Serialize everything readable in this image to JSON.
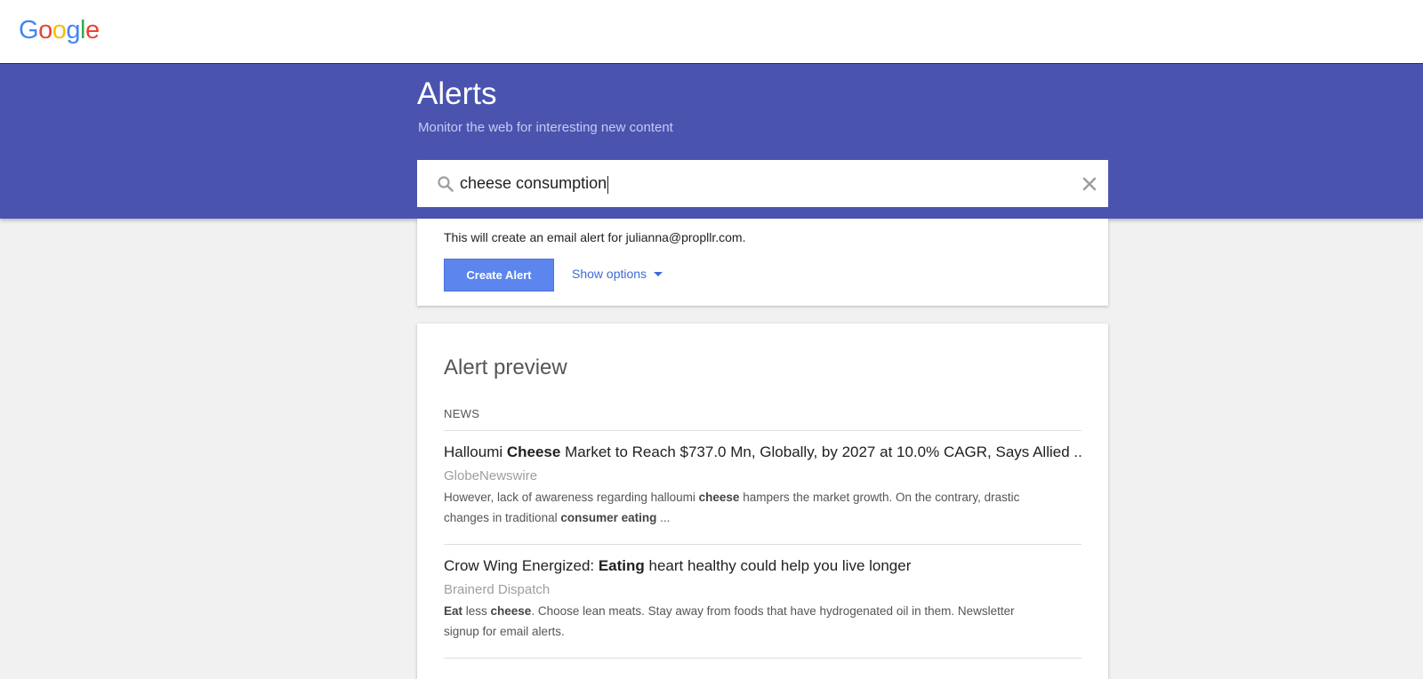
{
  "logo": {
    "letters": [
      "G",
      "o",
      "o",
      "g",
      "l",
      "e"
    ],
    "colors": [
      "#4285f4",
      "#ea4335",
      "#fbbc05",
      "#4285f4",
      "#34a853",
      "#ea4335"
    ]
  },
  "hero": {
    "title": "Alerts",
    "subtitle": "Monitor the web for interesting new content",
    "background": "#4a54af"
  },
  "search": {
    "value": "cheese consumption",
    "icon": "search-icon",
    "clear_icon": "close-icon"
  },
  "create": {
    "info": "This will create an email alert for julianna@propllr.com.",
    "button_label": "Create Alert",
    "options_label": "Show options",
    "accent": "#5c85ed"
  },
  "preview": {
    "title": "Alert preview",
    "section_label": "NEWS",
    "articles": [
      {
        "title_parts": [
          "Halloumi ",
          "Cheese",
          " Market to Reach $737.0 Mn, Globally, by 2027 at 10.0% CAGR, Says Allied ..."
        ],
        "source": "GlobeNewswire",
        "snippet_line1_parts": [
          "However, lack of awareness regarding halloumi ",
          "cheese",
          " hampers the market growth. On the contrary, drastic"
        ],
        "snippet_line2_parts": [
          "changes in traditional ",
          "consumer eating",
          " ..."
        ]
      },
      {
        "title_parts": [
          "Crow Wing Energized: ",
          "Eating",
          " heart healthy could help you live longer"
        ],
        "source": "Brainerd Dispatch",
        "snippet_line1_parts": [
          "Eat",
          " less ",
          "cheese",
          ". Choose lean meats. Stay away from foods that have hydrogenated oil in them. Newsletter"
        ],
        "snippet_line2_parts": [
          "signup for email alerts."
        ]
      }
    ]
  }
}
